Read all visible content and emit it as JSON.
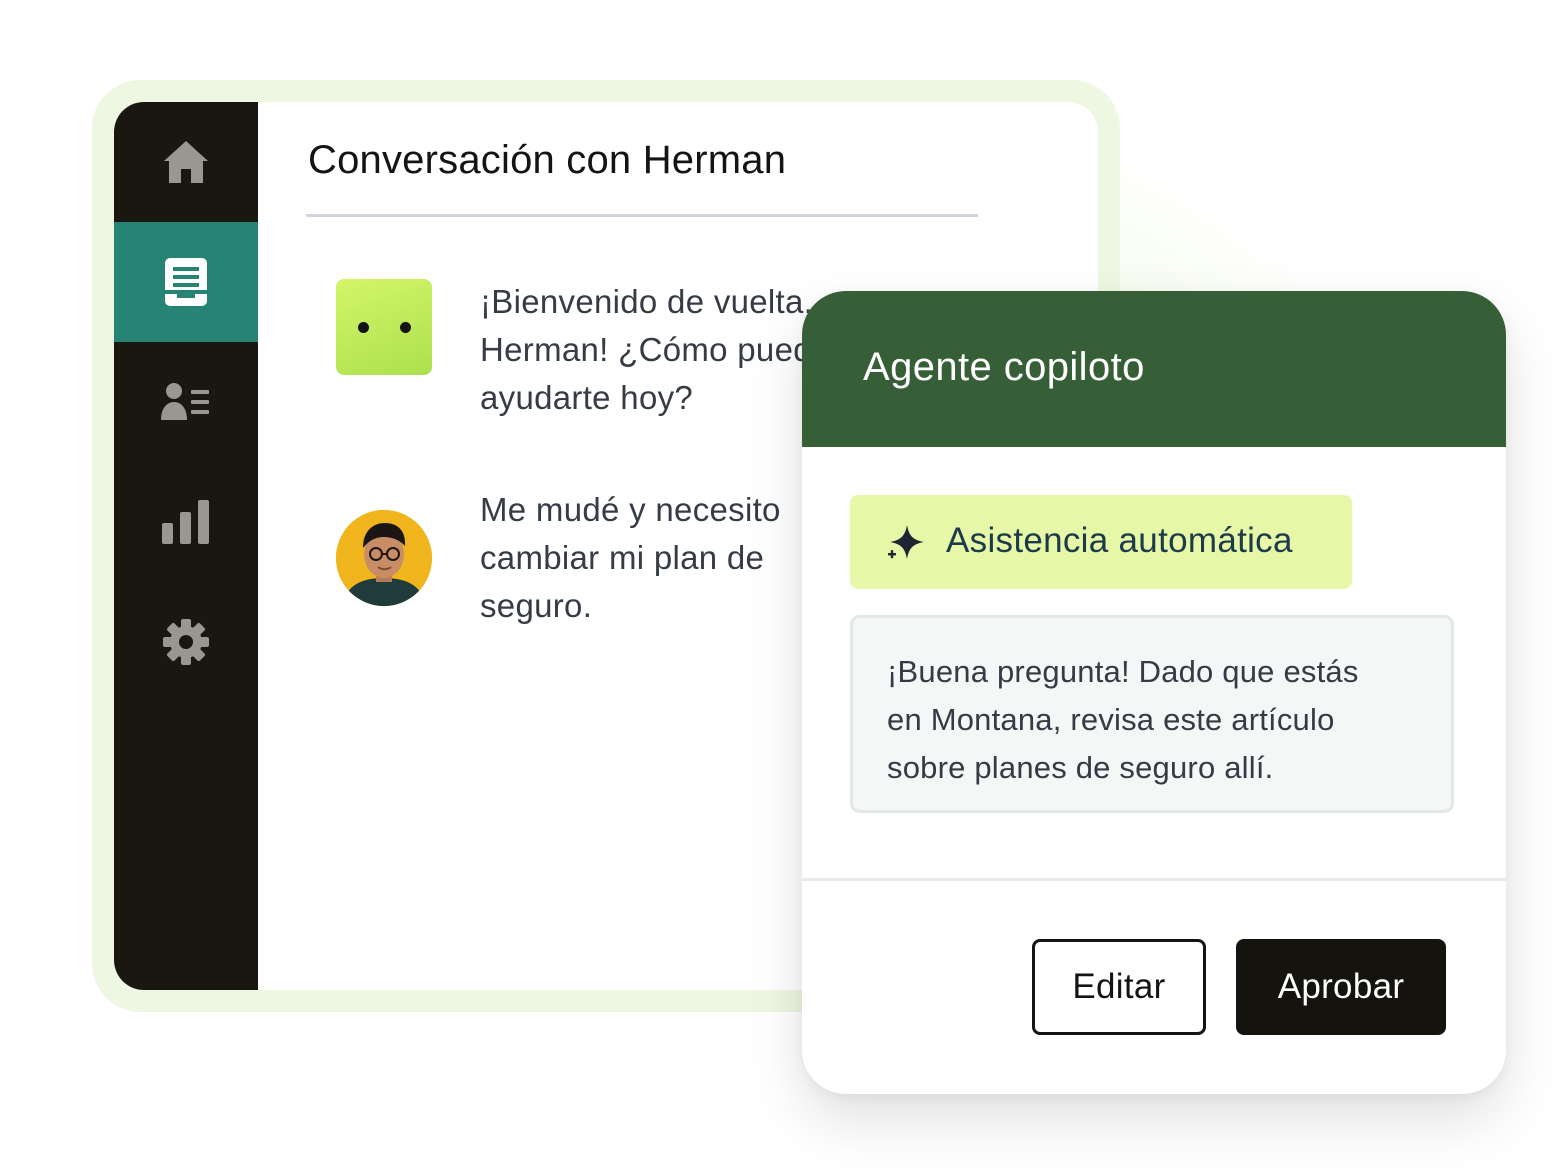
{
  "sidebar": {
    "items": [
      {
        "icon": "home-icon",
        "active": false
      },
      {
        "icon": "inbox-icon",
        "active": true
      },
      {
        "icon": "contacts-icon",
        "active": false
      },
      {
        "icon": "reports-icon",
        "active": false
      },
      {
        "icon": "settings-icon",
        "active": false
      }
    ],
    "colors": {
      "background": "#1a1711",
      "active": "#258474",
      "icon": "#9a9791",
      "active_icon": "#ffffff"
    }
  },
  "conversation": {
    "title": "Conversación con Herman",
    "messages": [
      {
        "sender": "bot",
        "lines": [
          "¡Bienvenido de vuelta,",
          "Herman! ¿Cómo puedo",
          "ayudarte hoy?"
        ]
      },
      {
        "sender": "user",
        "lines": [
          "Me mudé y necesito",
          "cambiar mi plan de",
          "seguro."
        ]
      }
    ]
  },
  "copilot": {
    "title": "Agente copiloto",
    "header_color": "#365e37",
    "assist_label": "Asistencia automática",
    "assist_icon": "sparkle-icon",
    "suggestion_lines": [
      "¡Buena pregunta! Dado que estás",
      "en Montana, revisa este artículo",
      "sobre planes de seguro allí."
    ],
    "edit_label": "Editar",
    "approve_label": "Aprobar"
  }
}
